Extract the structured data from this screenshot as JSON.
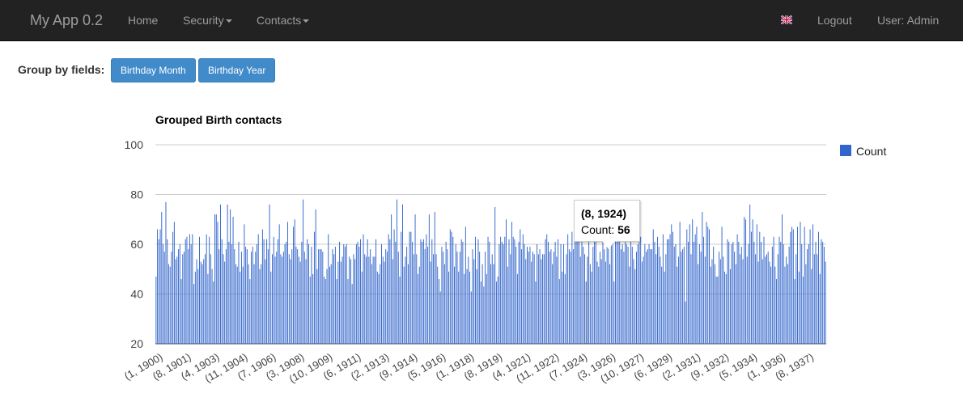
{
  "navbar": {
    "brand": "My App 0.2",
    "items": [
      {
        "label": "Home",
        "dropdown": false
      },
      {
        "label": "Security",
        "dropdown": true
      },
      {
        "label": "Contacts",
        "dropdown": true
      }
    ],
    "right": {
      "flag": "uk-flag-icon",
      "logout": "Logout",
      "user": "User: Admin"
    },
    "colors": {
      "background": "#222222",
      "text": "#9d9d9d"
    }
  },
  "group_by": {
    "label": "Group by fields:",
    "buttons": [
      "Birthday Month",
      "Birthday Year"
    ],
    "button_color": "#428bca"
  },
  "tooltip": {
    "title": "(8, 1924)",
    "label": "Count:",
    "value": "56"
  },
  "chart_data": {
    "type": "bar",
    "title": "Grouped Birth contacts",
    "xlabel": "",
    "ylabel": "",
    "ylim": [
      20,
      100
    ],
    "yticks": [
      20,
      40,
      60,
      80,
      100
    ],
    "grid": true,
    "legend": "right",
    "series_color": "#3366cc",
    "highlight_color": "#2b4fa0",
    "highlight_category": "(8, 1924)",
    "series": [
      {
        "name": "Count",
        "values": [
          47,
          66,
          62,
          66,
          73,
          60,
          57,
          77,
          62,
          52,
          51,
          57,
          65,
          69,
          54,
          55,
          58,
          60,
          46,
          56,
          57,
          62,
          63,
          58,
          64,
          60,
          64,
          44,
          49,
          54,
          50,
          63,
          53,
          52,
          54,
          56,
          64,
          48,
          63,
          56,
          50,
          45,
          72,
          72,
          69,
          58,
          76,
          62,
          56,
          53,
          58,
          76,
          61,
          74,
          60,
          71,
          58,
          52,
          51,
          61,
          49,
          57,
          51,
          68,
          59,
          58,
          52,
          46,
          57,
          59,
          52,
          57,
          60,
          64,
          50,
          52,
          66,
          62,
          54,
          62,
          58,
          76,
          49,
          56,
          63,
          55,
          57,
          62,
          68,
          56,
          55,
          57,
          60,
          61,
          69,
          56,
          54,
          58,
          67,
          70,
          59,
          58,
          55,
          53,
          61,
          78,
          57,
          54,
          62,
          60,
          47,
          59,
          48,
          65,
          74,
          50,
          58,
          58,
          58,
          57,
          47,
          46,
          50,
          64,
          51,
          52,
          58,
          56,
          59,
          46,
          53,
          61,
          53,
          55,
          60,
          59,
          60,
          46,
          55,
          54,
          44,
          56,
          54,
          60,
          61,
          59,
          62,
          49,
          64,
          56,
          55,
          62,
          55,
          58,
          52,
          55,
          55,
          62,
          49,
          48,
          52,
          60,
          55,
          53,
          58,
          57,
          64,
          62,
          72,
          54,
          66,
          61,
          78,
          57,
          47,
          65,
          76,
          51,
          55,
          59,
          52,
          65,
          65,
          61,
          56,
          72,
          56,
          48,
          51,
          62,
          61,
          62,
          58,
          64,
          59,
          72,
          53,
          62,
          56,
          73,
          56,
          51,
          46,
          41,
          59,
          57,
          52,
          61,
          58,
          49,
          66,
          65,
          63,
          51,
          60,
          57,
          49,
          57,
          62,
          61,
          48,
          67,
          50,
          55,
          49,
          41,
          58,
          54,
          63,
          50,
          62,
          57,
          45,
          52,
          43,
          57,
          48,
          63,
          61,
          52,
          56,
          52,
          75,
          45,
          47,
          60,
          63,
          61,
          60,
          63,
          70,
          51,
          62,
          56,
          69,
          63,
          62,
          59,
          48,
          61,
          66,
          58,
          64,
          60,
          54,
          59,
          57,
          59,
          53,
          57,
          56,
          45,
          60,
          56,
          58,
          54,
          56,
          56,
          62,
          64,
          61,
          57,
          58,
          52,
          57,
          61,
          55,
          62,
          46,
          60,
          49,
          60,
          48,
          56,
          64,
          58,
          57,
          65,
          58,
          70,
          61,
          65,
          61,
          55,
          64,
          59,
          56,
          45,
          55,
          63,
          52,
          49,
          59,
          61,
          64,
          53,
          51,
          57,
          54,
          62,
          58,
          53,
          63,
          66,
          52,
          61,
          69,
          45,
          63,
          61,
          71,
          66,
          58,
          60,
          57,
          68,
          60,
          59,
          51,
          63,
          59,
          54,
          50,
          57,
          60,
          61,
          63,
          53,
          55,
          60,
          57,
          58,
          60,
          58,
          58,
          66,
          61,
          56,
          63,
          59,
          55,
          51,
          64,
          49,
          56,
          62,
          62,
          64,
          68,
          65,
          59,
          60,
          51,
          55,
          69,
          57,
          58,
          59,
          37,
          66,
          61,
          68,
          56,
          70,
          61,
          64,
          67,
          52,
          60,
          57,
          73,
          63,
          55,
          69,
          67,
          66,
          51,
          54,
          59,
          52,
          47,
          47,
          57,
          54,
          67,
          55,
          49,
          48,
          62,
          61,
          50,
          60,
          61,
          57,
          52,
          64,
          61,
          56,
          59,
          54,
          71,
          70,
          55,
          60,
          76,
          65,
          70,
          61,
          56,
          68,
          53,
          65,
          61,
          54,
          63,
          55,
          56,
          57,
          53,
          51,
          59,
          63,
          51,
          46,
          56,
          63,
          61,
          72,
          60,
          51,
          55,
          52,
          59,
          65,
          67,
          66,
          46,
          56,
          67,
          49,
          69,
          60,
          47,
          67,
          52,
          58,
          60,
          66,
          50,
          68,
          56,
          61,
          56,
          65,
          48,
          62,
          61,
          59,
          53
        ]
      }
    ],
    "categories_labeled": [
      "(1, 1900)",
      "(8, 1901)",
      "(4, 1903)",
      "(11, 1904)",
      "(7, 1906)",
      "(3, 1908)",
      "(10, 1909)",
      "(6, 1911)",
      "(2, 1913)",
      "(9, 1914)",
      "(5, 1916)",
      "(1, 1918)",
      "(8, 1919)",
      "(4, 1921)",
      "(11, 1922)",
      "(7, 1924)",
      "(3, 1926)",
      "(10, 1927)",
      "(6, 1929)",
      "(2, 1931)",
      "(9, 1932)",
      "(5, 1934)",
      "(1, 1936)",
      "(8, 1937)"
    ]
  }
}
